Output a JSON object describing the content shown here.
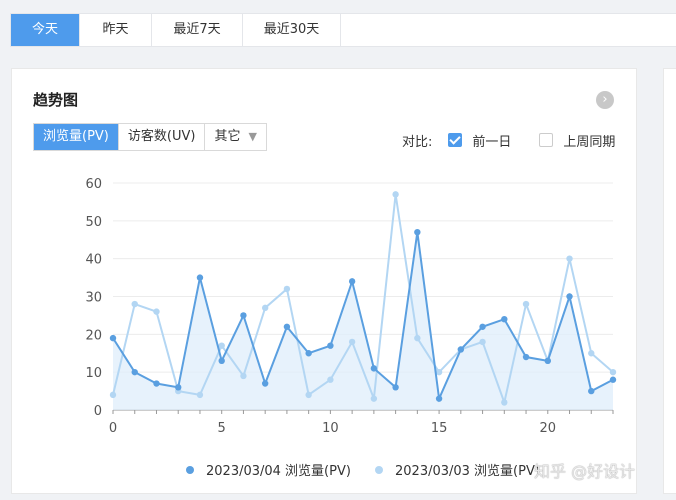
{
  "range_tabs": [
    "今天",
    "昨天",
    "最近7天",
    "最近30天"
  ],
  "active_range": 0,
  "card": {
    "title": "趋势图",
    "metric_tabs": [
      "浏览量(PV)",
      "访客数(UV)",
      "其它"
    ],
    "active_metric": 0,
    "compare_label": "对比:",
    "compare_options": [
      {
        "label": "前一日",
        "checked": true
      },
      {
        "label": "上周同期",
        "checked": false
      }
    ]
  },
  "watermark": "知乎 @好设计",
  "colors": {
    "accent": "#4e9bec",
    "series_current": "#5a9fe0",
    "series_previous": "#b3d6f3"
  },
  "chart_data": {
    "type": "line",
    "x": [
      0,
      1,
      2,
      3,
      4,
      5,
      6,
      7,
      8,
      9,
      10,
      11,
      12,
      13,
      14,
      15,
      16,
      17,
      18,
      19,
      20,
      21,
      22,
      23
    ],
    "xticks": [
      0,
      5,
      10,
      15,
      20
    ],
    "ylim": [
      0,
      60
    ],
    "yticks": [
      0,
      10,
      20,
      30,
      40,
      50,
      60
    ],
    "series": [
      {
        "name": "2023/03/04 浏览量(PV)",
        "values": [
          19,
          10,
          7,
          6,
          35,
          13,
          25,
          7,
          22,
          15,
          17,
          34,
          11,
          6,
          47,
          3,
          16,
          22,
          24,
          14,
          13,
          30,
          5,
          8
        ]
      },
      {
        "name": "2023/03/03 浏览量(PV)",
        "values": [
          4,
          28,
          26,
          5,
          4,
          17,
          9,
          27,
          32,
          4,
          8,
          18,
          3,
          57,
          19,
          10,
          16,
          18,
          2,
          28,
          13,
          40,
          15,
          10
        ]
      }
    ]
  }
}
